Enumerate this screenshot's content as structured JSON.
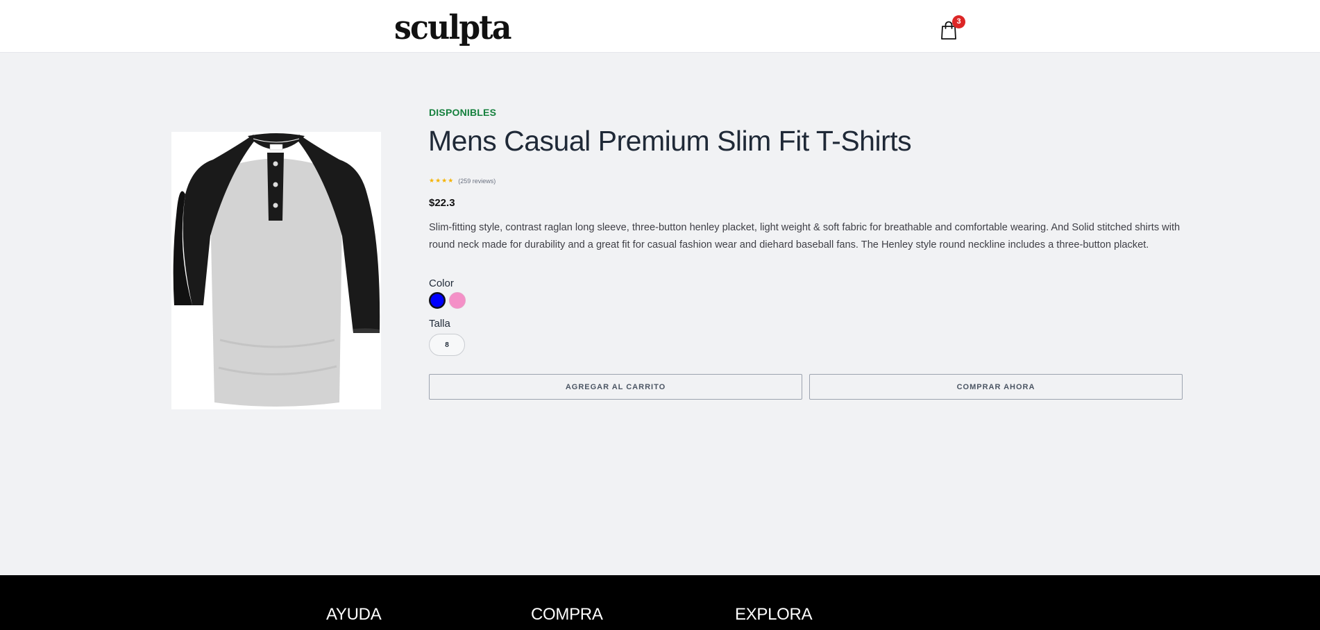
{
  "header": {
    "logo": "sculpta",
    "cart_count": "3"
  },
  "product": {
    "availability": "DISPONIBLES",
    "title": "Mens Casual Premium Slim Fit T-Shirts",
    "rating_stars": "★★★★",
    "reviews": "(259 reviews)",
    "price": "$22.3",
    "description": "Slim-fitting style, contrast raglan long sleeve, three-button henley placket, light weight & soft fabric for breathable and comfortable wearing. And Solid stitched shirts with round neck made for durability and a great fit for casual fashion wear and diehard baseball fans. The Henley style round neckline includes a three-button placket.",
    "color_label": "Color",
    "colors": [
      "#0000ff",
      "#f490c7"
    ],
    "size_label": "Talla",
    "size_value": "8",
    "add_to_cart_label": "AGREGAR AL CARRITO",
    "buy_now_label": "COMPRAR AHORA"
  },
  "footer": {
    "col1": "AYUDA",
    "col2": "COMPRA",
    "col3": "EXPLORA"
  }
}
